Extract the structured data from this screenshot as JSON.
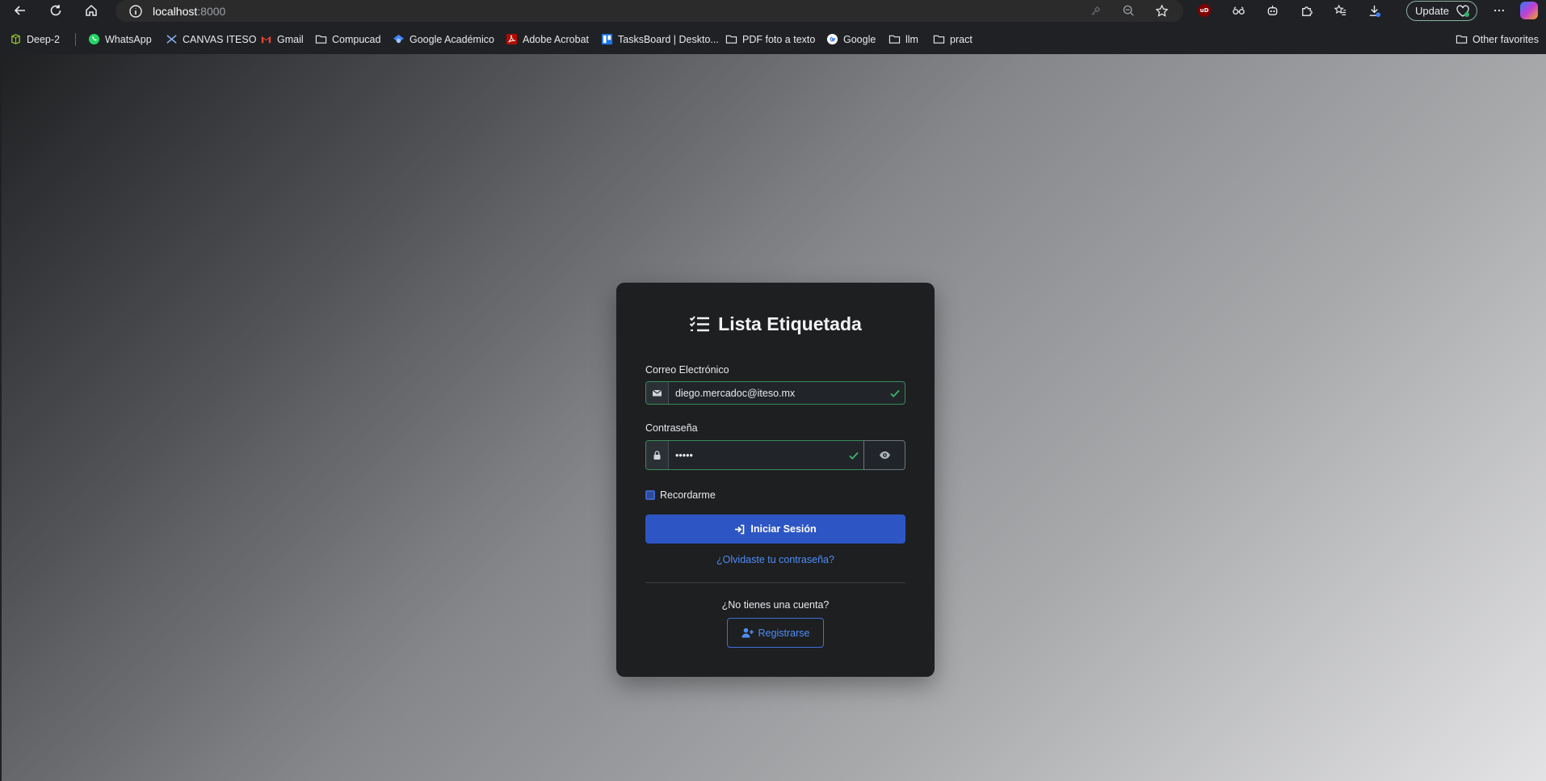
{
  "browser": {
    "url_host": "localhost",
    "url_port": ":8000",
    "update_label": "Update",
    "bookmarks": [
      {
        "label": "Deep-2",
        "icon": "deepnote-icon"
      },
      {
        "label": "WhatsApp",
        "icon": "whatsapp-icon"
      },
      {
        "label": "CANVAS ITESO",
        "icon": "canvas-icon"
      },
      {
        "label": "Gmail",
        "icon": "gmail-icon"
      },
      {
        "label": "Compucad",
        "icon": "folder-icon"
      },
      {
        "label": "Google Académico",
        "icon": "scholar-icon"
      },
      {
        "label": "Adobe Acrobat",
        "icon": "acrobat-icon"
      },
      {
        "label": "TasksBoard | Deskto...",
        "icon": "tasksboard-icon"
      },
      {
        "label": "PDF foto a texto",
        "icon": "folder-icon"
      },
      {
        "label": "Google",
        "icon": "google-icon"
      },
      {
        "label": "llm",
        "icon": "folder-icon"
      },
      {
        "label": "pract",
        "icon": "folder-icon"
      }
    ],
    "other_favorites": "Other favorites"
  },
  "login": {
    "title": "Lista Etiquetada",
    "email_label": "Correo Electrónico",
    "email_value": "diego.mercadoc@iteso.mx",
    "password_label": "Contraseña",
    "password_value": "•••••",
    "remember_label": "Recordarme",
    "remember_checked": false,
    "login_button": "Iniciar Sesión",
    "forgot_link": "¿Olvidaste tu contraseña?",
    "no_account_text": "¿No tienes una cuenta?",
    "register_button": "Registrarse"
  },
  "colors": {
    "card_bg": "#1d1f21",
    "primary": "#2d55c4",
    "link": "#4f8df7",
    "valid": "#3b8c5a"
  }
}
